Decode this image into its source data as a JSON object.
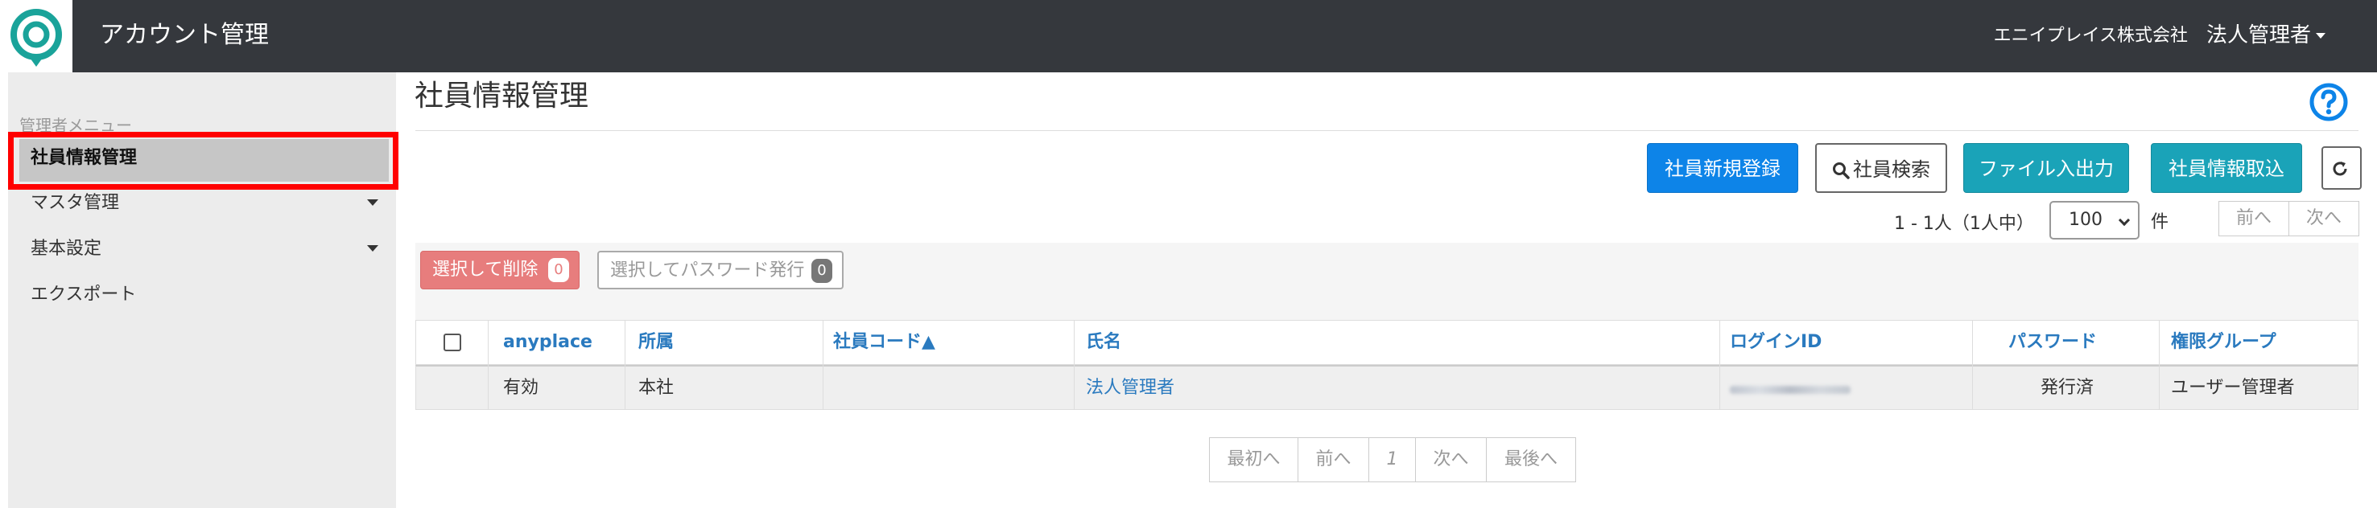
{
  "header": {
    "app_title": "アカウント管理",
    "company": "エニイプレイス株式会社",
    "user_menu": "法人管理者"
  },
  "sidebar": {
    "menu_title": "管理者メニュー",
    "items": [
      {
        "label": "社員情報管理",
        "active": true,
        "has_caret": false
      },
      {
        "label": "マスタ管理",
        "active": false,
        "has_caret": true
      },
      {
        "label": "基本設定",
        "active": false,
        "has_caret": true
      },
      {
        "label": "エクスポート",
        "active": false,
        "has_caret": false
      }
    ]
  },
  "main": {
    "page_title": "社員情報管理",
    "buttons": {
      "new_employee": "社員新規登録",
      "search": "社員検索",
      "file_io": "ファイル入出力",
      "import": "社員情報取込"
    },
    "count_text": "1 - 1人（1人中）",
    "per_page": "100",
    "unit": "件",
    "pager_top": {
      "prev": "前へ",
      "next": "次へ"
    },
    "bulk": {
      "delete_label": "選択して削除",
      "delete_count": "0",
      "password_label": "選択してパスワード発行",
      "password_count": "0"
    },
    "table": {
      "headers": [
        "anyplace",
        "所属",
        "社員コード▲",
        "氏名",
        "ログインID",
        "パスワード",
        "権限グループ"
      ],
      "rows": [
        {
          "anyplace": "有効",
          "dept": "本社",
          "code": "",
          "name": "法人管理者",
          "login_id": "",
          "password": "発行済",
          "group": "ユーザー管理者"
        }
      ]
    },
    "pager": {
      "first": "最初へ",
      "prev": "前へ",
      "current": "1",
      "next": "次へ",
      "last": "最後へ"
    }
  },
  "colors": {
    "header_bg": "#35383d",
    "primary_blue": "#0d84e8",
    "teal": "#1aa3b8",
    "danger": "#e77d7d",
    "link": "#2a7abf",
    "highlight": "#ff0000"
  }
}
